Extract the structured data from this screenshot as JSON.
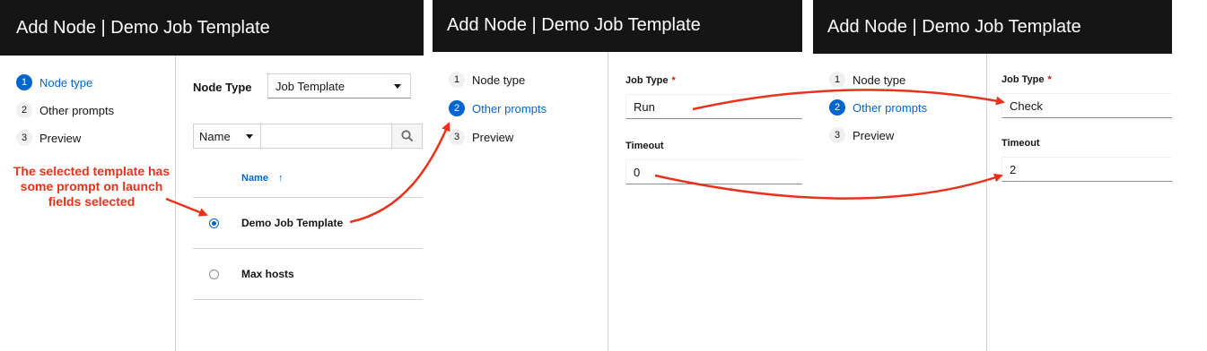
{
  "panels": [
    {
      "title": "Add Node | Demo Job Template",
      "steps": [
        "Node type",
        "Other prompts",
        "Preview"
      ],
      "step_numbers": [
        "1",
        "2",
        "3"
      ],
      "active_step": 1,
      "node_type_label": "Node Type",
      "node_type_value": "Job Template",
      "filter_field": "Name",
      "column_header": "Name",
      "rows": [
        {
          "name": "Demo Job Template",
          "selected": true
        },
        {
          "name": "Max hosts",
          "selected": false
        }
      ],
      "annotation": "The selected template has some prompt on launch fields selected"
    },
    {
      "title": "Add Node | Demo Job Template",
      "steps": [
        "Node type",
        "Other prompts",
        "Preview"
      ],
      "step_numbers": [
        "1",
        "2",
        "3"
      ],
      "active_step": 2,
      "job_type_label": "Job Type",
      "required_mark": "*",
      "job_type_value": "Run",
      "timeout_label": "Timeout",
      "timeout_value": "0"
    },
    {
      "title": "Add Node | Demo Job Template",
      "steps": [
        "Node type",
        "Other prompts",
        "Preview"
      ],
      "step_numbers": [
        "1",
        "2",
        "3"
      ],
      "active_step": 2,
      "job_type_label": "Job Type",
      "required_mark": "*",
      "job_type_value": "Check",
      "timeout_label": "Timeout",
      "timeout_value": "2"
    }
  ],
  "icons": {
    "search": "search-icon",
    "sort": "sort-ascending-icon",
    "caret": "caret-down-icon"
  },
  "colors": {
    "header_bg": "#151515",
    "accent": "#0066cc",
    "annotation": "#e8331c"
  }
}
